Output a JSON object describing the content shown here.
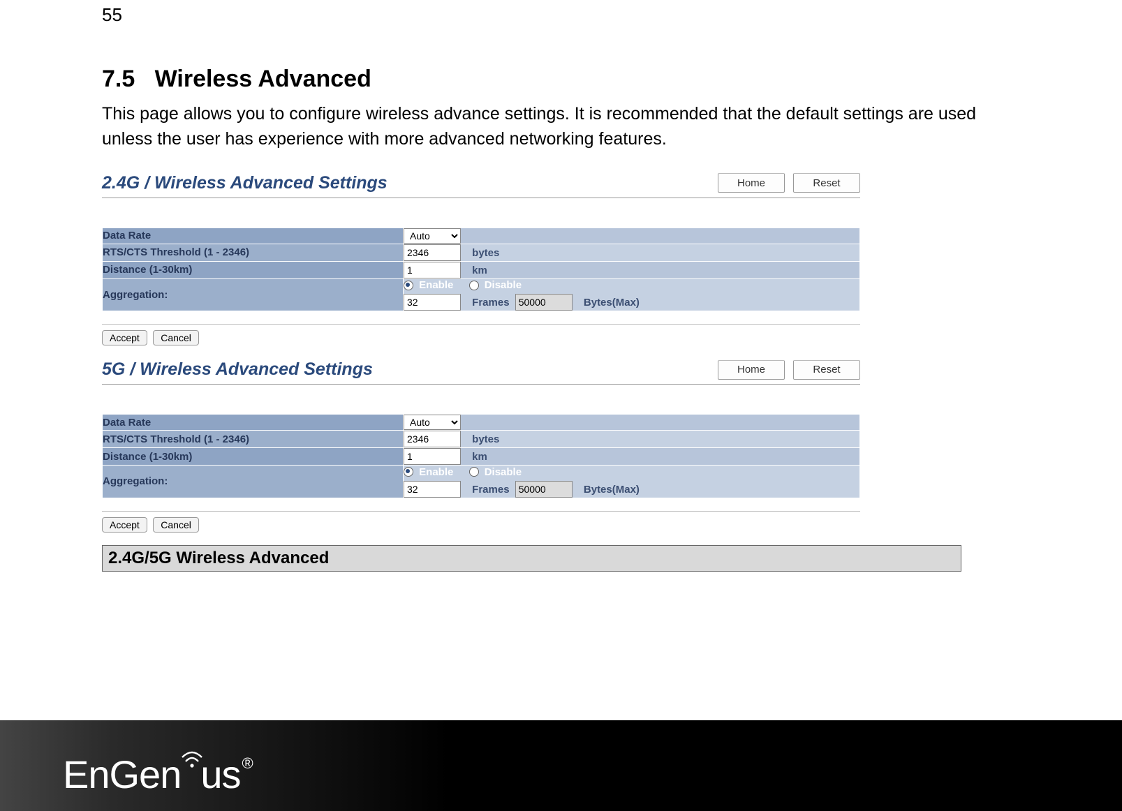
{
  "page_number": "55",
  "section_number": "7.5",
  "section_title": "Wireless Advanced",
  "intro_text": "This page allows you to configure wireless advance settings. It is recommended that the default settings are used unless the user has experience with more advanced networking features.",
  "panels": [
    {
      "title": "2.4G / Wireless Advanced Settings",
      "home_btn": "Home",
      "reset_btn": "Reset",
      "rows": {
        "data_rate_label": "Data Rate",
        "data_rate_value": "Auto",
        "rtscts_label": "RTS/CTS Threshold (1 - 2346)",
        "rtscts_value": "2346",
        "rtscts_unit": "bytes",
        "distance_label": "Distance (1-30km)",
        "distance_value": "1",
        "distance_unit": "km",
        "aggregation_label": "Aggregation:",
        "agg_enable": "Enable",
        "agg_disable": "Disable",
        "agg_frames_value": "32",
        "agg_frames_unit": "Frames",
        "agg_bytes_value": "50000",
        "agg_bytes_unit": "Bytes(Max)"
      },
      "accept_btn": "Accept",
      "cancel_btn": "Cancel"
    },
    {
      "title": "5G / Wireless Advanced Settings",
      "home_btn": "Home",
      "reset_btn": "Reset",
      "rows": {
        "data_rate_label": "Data Rate",
        "data_rate_value": "Auto",
        "rtscts_label": "RTS/CTS Threshold (1 - 2346)",
        "rtscts_value": "2346",
        "rtscts_unit": "bytes",
        "distance_label": "Distance (1-30km)",
        "distance_value": "1",
        "distance_unit": "km",
        "aggregation_label": "Aggregation:",
        "agg_enable": "Enable",
        "agg_disable": "Disable",
        "agg_frames_value": "32",
        "agg_frames_unit": "Frames",
        "agg_bytes_value": "50000",
        "agg_bytes_unit": "Bytes(Max)"
      },
      "accept_btn": "Accept",
      "cancel_btn": "Cancel"
    }
  ],
  "info_table_title": "2.4G/5G Wireless Advanced",
  "logo_text_1": "EnGen",
  "logo_text_2": "us",
  "logo_reg": "®"
}
